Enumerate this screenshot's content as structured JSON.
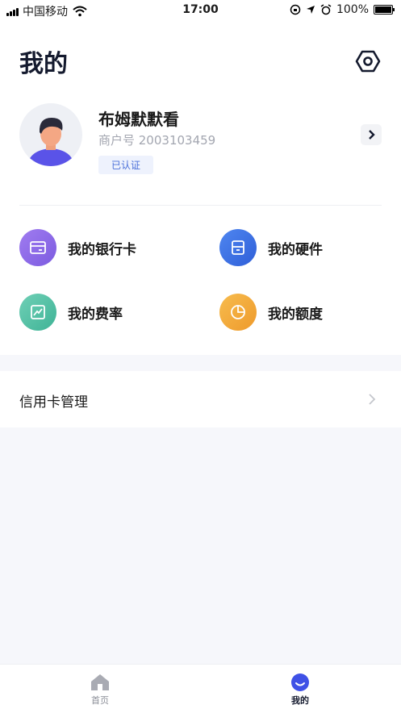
{
  "status_bar": {
    "carrier": "中国移动",
    "time": "17:00",
    "battery": "100%"
  },
  "page": {
    "title": "我的",
    "settings_icon": "hexagon-settings-icon"
  },
  "profile": {
    "name": "布姆默默看",
    "merchant_label": "商户号 2003103459",
    "status_badge": "已认证"
  },
  "menu": [
    {
      "label": "我的银行卡",
      "icon": "card-icon",
      "color": "#8f6ee8"
    },
    {
      "label": "我的硬件",
      "icon": "device-icon",
      "color": "#3f74e8"
    },
    {
      "label": "我的费率",
      "icon": "chart-icon",
      "color": "#4dbfa5"
    },
    {
      "label": "我的额度",
      "icon": "pie-icon",
      "color": "#f2a43a"
    }
  ],
  "list": {
    "credit_card_management": "信用卡管理"
  },
  "tabs": [
    {
      "label": "首页",
      "active": false
    },
    {
      "label": "我的",
      "active": true
    }
  ],
  "colors": {
    "accent": "#3f51e6",
    "background": "#f6f7fb"
  }
}
